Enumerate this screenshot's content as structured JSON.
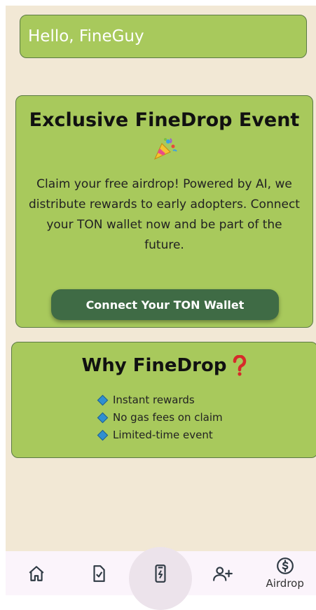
{
  "header": {
    "greeting": "Hello, FineGuy"
  },
  "event": {
    "title": "Exclusive FineDrop Event",
    "icon": "party-popper-icon",
    "description": "Claim your free airdrop! Powered by AI, we distribute rewards to early adopters. Connect your TON wallet now and be part of the future.",
    "button_label": "Connect Your TON Wallet"
  },
  "why": {
    "title": "Why FineDrop",
    "icon": "red-question-mark-icon",
    "items": [
      "Instant rewards",
      "No gas fees on claim",
      "Limited-time event"
    ]
  },
  "nav": {
    "items": [
      {
        "icon": "home-icon",
        "label": ""
      },
      {
        "icon": "task-check-icon",
        "label": ""
      },
      {
        "icon": "mobile-charge-icon",
        "label": ""
      },
      {
        "icon": "add-friend-icon",
        "label": ""
      },
      {
        "icon": "dollar-coin-icon",
        "label": "Airdrop"
      }
    ]
  },
  "colors": {
    "background": "#f2e8d5",
    "card": "#a8c95c",
    "card_border": "#5b7a44",
    "button": "#3f6b45",
    "bullet": "#2f8fd1"
  }
}
